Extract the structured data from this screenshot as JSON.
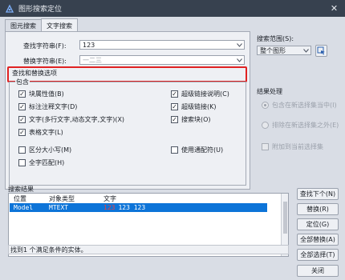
{
  "window": {
    "title": "图形搜索定位",
    "close_glyph": "✕"
  },
  "tabs": [
    {
      "label": "图元搜索",
      "active": false
    },
    {
      "label": "文字搜索",
      "active": true
    }
  ],
  "find": {
    "label": "查找字符串(F):",
    "value": "123"
  },
  "replace": {
    "label": "替换字符串(E):",
    "value": "一二三"
  },
  "options": {
    "group_title": "查找和替换选项",
    "include_label": "包含",
    "block_attr": {
      "label": "块属性值(B)",
      "checked": true
    },
    "dim_text": {
      "label": "标注注释文字(D)",
      "checked": true
    },
    "text": {
      "label": "文字(多行文字,动态文字,文字)(X)",
      "checked": true
    },
    "table_text": {
      "label": "表格文字(L)",
      "checked": true
    },
    "hyperlink_desc": {
      "label": "超级链接说明(C)",
      "checked": true
    },
    "hyperlink": {
      "label": "超级链接(K)",
      "checked": true
    },
    "search_block": {
      "label": "搜索块(O)",
      "checked": true
    },
    "match_case": {
      "label": "区分大小写(M)",
      "checked": false
    },
    "whole_word": {
      "label": "全字匹配(H)",
      "checked": false
    },
    "wildcard": {
      "label": "使用通配符(U)",
      "checked": false
    }
  },
  "scope": {
    "label": "搜索范围(S):",
    "value": "整个图形"
  },
  "result_handling": {
    "title": "结果处理",
    "include_new": "包含在新选择集当中(I)",
    "exclude_new": "排除在新选择集之外(E)",
    "append": "附加到当前选择集"
  },
  "results": {
    "title": "搜索结果",
    "columns": [
      "位置",
      "对象类型",
      "文字"
    ],
    "rows": [
      {
        "location": "Model",
        "type": "MTEXT",
        "text_prefix": "123",
        "text": "123 123"
      }
    ]
  },
  "status": "找到1 个满足条件的实体。",
  "buttons": {
    "find_next": "查找下个(N)",
    "replace": "替换(R)",
    "locate": "定位(G)",
    "replace_all": "全部替换(A)",
    "select_all": "全部选择(T)",
    "close": "关闭"
  },
  "colors": {
    "highlight": "#e02222",
    "selection": "#0d74d8",
    "titlebar": "#37414f"
  }
}
